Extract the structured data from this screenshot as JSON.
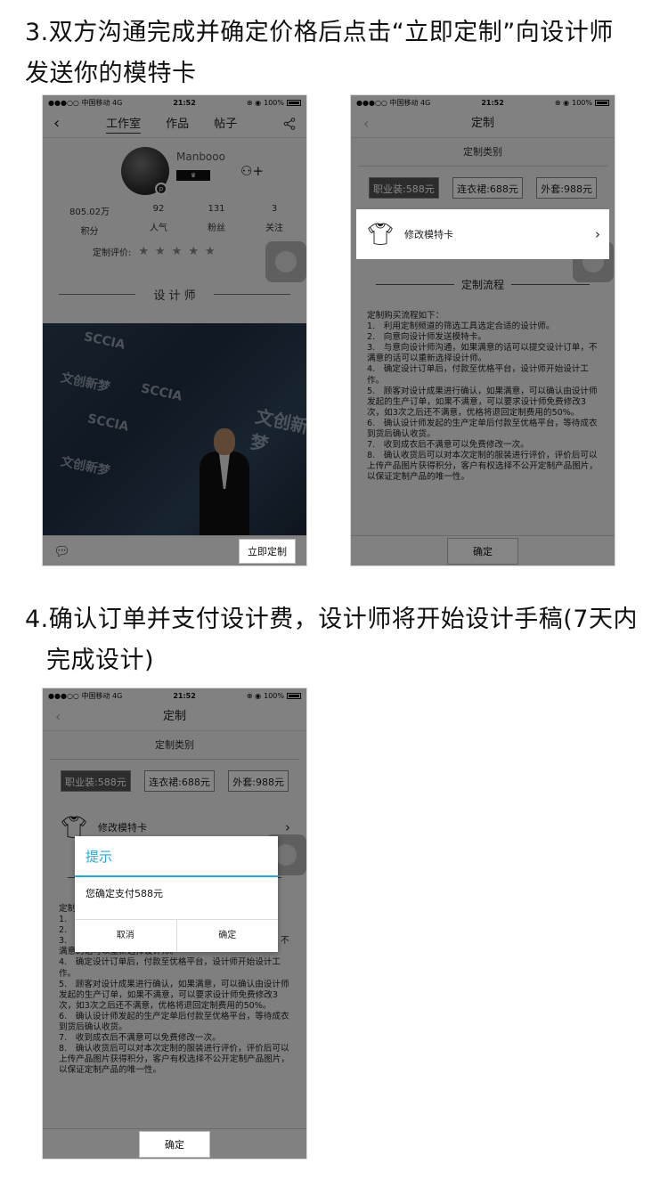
{
  "step3": {
    "title_line1": "3.双方沟通完成并确定价格后点击“立即定制”向设计师",
    "title_line2": "发送你的模特卡"
  },
  "step4": {
    "title_line1": "4.确认订单并支付设计费，设计师将开始设计手稿(7天内",
    "title_line2": "完成设计)"
  },
  "status_bar": {
    "carrier": "●●●○○ 中国移动  4G",
    "time": "21:52",
    "battery": "100%"
  },
  "studio_page": {
    "tabs": [
      "工作室",
      "作品",
      "帖子"
    ],
    "name": "Manbooo",
    "stats": [
      {
        "value": "805.02万",
        "label": "积分"
      },
      {
        "value": "92",
        "label": "人气"
      },
      {
        "value": "131",
        "label": "粉丝"
      },
      {
        "value": "3",
        "label": "关注"
      }
    ],
    "rating_label": "定制评价:",
    "stars": "★★★★★",
    "section_title": "设 计 师",
    "photo_wall_text": [
      "SCCIA",
      "文创新梦",
      "SCCIA",
      "文创新梦",
      "SCCIA",
      "文创新梦"
    ],
    "buy_button": "立即定制"
  },
  "custom_page": {
    "title": "定制",
    "category_label": "定制类别",
    "chips": [
      "职业装:588元",
      "连衣裙:688元",
      "外套:988元"
    ],
    "model_card_label": "修改模特卡",
    "flow_title": "定制流程",
    "steps": [
      "定制购买流程如下：",
      "1.　利用定制频道的筛选工具选定合适的设计师。",
      "2.　向意向设计师发送模特卡。",
      "3.　与意向设计师沟通，如果满意的话可以提交设计订单，不满意的话可以重新选择设计师。",
      "4.　确定设计订单后，付款至优格平台，设计师开始设计工作。",
      "5.　顾客对设计成果进行确认，如果满意，可以确认由设计师发起的生产订单，如果不满意，可以要求设计师免费修改3次，如3次之后还不满意，优格将退回定制费用的50%。",
      "6.　确认设计师发起的生产定单后付款至优格平台，等待成衣到货后确认收货。",
      "7.　收到成衣后不满意可以免费修改一次。",
      "8.　确认收货后可以对本次定制的服装进行评价，评价后可以上传产品图片获得积分，客户有权选择不公开定制产品图片，以保证定制产品的唯一性。"
    ],
    "confirm_button": "确定"
  },
  "dialog": {
    "title": "提示",
    "message": "您确定支付588元",
    "cancel": "取消",
    "confirm": "确定"
  },
  "colors": {
    "dialog_accent": "#2aa6d8",
    "overlay": "rgba(0,0,0,0.48)"
  },
  "icons": [
    "back-icon",
    "share-icon",
    "follow-icon",
    "chat-icon",
    "shirt-icon",
    "chevron-right-icon"
  ]
}
